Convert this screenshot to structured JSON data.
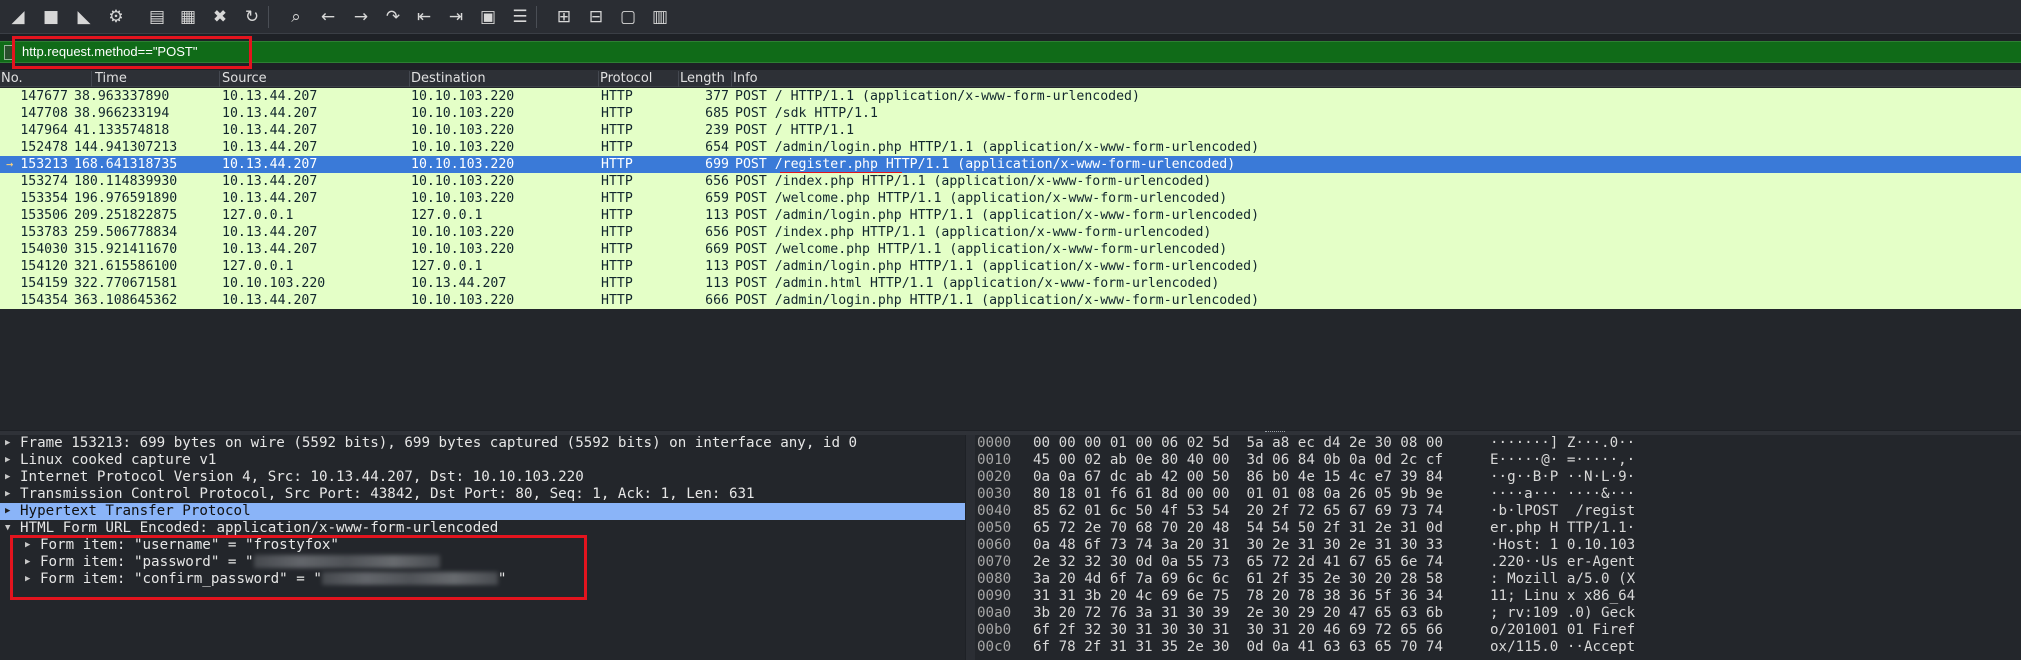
{
  "toolbar": {
    "buttons": [
      {
        "name": "start-capture-icon",
        "glyph": "◢"
      },
      {
        "name": "stop-capture-icon",
        "glyph": "■"
      },
      {
        "name": "restart-capture-icon",
        "glyph": "◣"
      },
      {
        "name": "capture-options-icon",
        "glyph": "⚙"
      },
      {
        "name": "open-file-icon",
        "glyph": "▤"
      },
      {
        "name": "save-file-icon",
        "glyph": "▦"
      },
      {
        "name": "close-file-icon",
        "glyph": "✖"
      },
      {
        "name": "reload-file-icon",
        "glyph": "↻"
      },
      {
        "name": "find-packet-icon",
        "glyph": "⌕"
      },
      {
        "name": "go-back-icon",
        "glyph": "←"
      },
      {
        "name": "go-forward-icon",
        "glyph": "→"
      },
      {
        "name": "go-to-packet-icon",
        "glyph": "↷"
      },
      {
        "name": "go-first-packet-icon",
        "glyph": "⇤"
      },
      {
        "name": "go-last-packet-icon",
        "glyph": "⇥"
      },
      {
        "name": "autoscroll-icon",
        "glyph": "▣"
      },
      {
        "name": "colorize-icon",
        "glyph": "☰"
      },
      {
        "name": "zoom-in-icon",
        "glyph": "⊞"
      },
      {
        "name": "zoom-out-icon",
        "glyph": "⊟"
      },
      {
        "name": "normal-size-icon",
        "glyph": "▢"
      },
      {
        "name": "resize-columns-icon",
        "glyph": "▥"
      }
    ]
  },
  "filter": {
    "value": "http.request.method==\"POST\""
  },
  "packet_list": {
    "columns": [
      "No.",
      "Time",
      "Source",
      "Destination",
      "Protocol",
      "Length",
      "Info"
    ],
    "selected_index": 4,
    "rows": [
      {
        "no": "147677",
        "time": "38.963337890",
        "src": "10.13.44.207",
        "dst": "10.10.103.220",
        "proto": "HTTP",
        "len": "377",
        "info": "POST / HTTP/1.1  (application/x-www-form-urlencoded)"
      },
      {
        "no": "147708",
        "time": "38.966233194",
        "src": "10.13.44.207",
        "dst": "10.10.103.220",
        "proto": "HTTP",
        "len": "685",
        "info": "POST /sdk HTTP/1.1"
      },
      {
        "no": "147964",
        "time": "41.133574818",
        "src": "10.13.44.207",
        "dst": "10.10.103.220",
        "proto": "HTTP",
        "len": "239",
        "info": "POST / HTTP/1.1"
      },
      {
        "no": "152478",
        "time": "144.941307213",
        "src": "10.13.44.207",
        "dst": "10.10.103.220",
        "proto": "HTTP",
        "len": "654",
        "info": "POST /admin/login.php HTTP/1.1  (application/x-www-form-urlencoded)"
      },
      {
        "no": "153213",
        "time": "168.641318735",
        "src": "10.13.44.207",
        "dst": "10.10.103.220",
        "proto": "HTTP",
        "len": "699",
        "info": "POST /register.php HTTP/1.1  (application/x-www-form-urlencoded)"
      },
      {
        "no": "153274",
        "time": "180.114839930",
        "src": "10.13.44.207",
        "dst": "10.10.103.220",
        "proto": "HTTP",
        "len": "656",
        "info": "POST /index.php HTTP/1.1  (application/x-www-form-urlencoded)"
      },
      {
        "no": "153354",
        "time": "196.976591890",
        "src": "10.13.44.207",
        "dst": "10.10.103.220",
        "proto": "HTTP",
        "len": "659",
        "info": "POST /welcome.php HTTP/1.1  (application/x-www-form-urlencoded)"
      },
      {
        "no": "153506",
        "time": "209.251822875",
        "src": "127.0.0.1",
        "dst": "127.0.0.1",
        "proto": "HTTP",
        "len": "113",
        "info": "POST /admin/login.php HTTP/1.1  (application/x-www-form-urlencoded)"
      },
      {
        "no": "153783",
        "time": "259.506778834",
        "src": "10.13.44.207",
        "dst": "10.10.103.220",
        "proto": "HTTP",
        "len": "656",
        "info": "POST /index.php HTTP/1.1  (application/x-www-form-urlencoded)"
      },
      {
        "no": "154030",
        "time": "315.921411670",
        "src": "10.13.44.207",
        "dst": "10.10.103.220",
        "proto": "HTTP",
        "len": "669",
        "info": "POST /welcome.php HTTP/1.1  (application/x-www-form-urlencoded)"
      },
      {
        "no": "154120",
        "time": "321.615586100",
        "src": "127.0.0.1",
        "dst": "127.0.0.1",
        "proto": "HTTP",
        "len": "113",
        "info": "POST /admin/login.php HTTP/1.1  (application/x-www-form-urlencoded)"
      },
      {
        "no": "154159",
        "time": "322.770671581",
        "src": "10.10.103.220",
        "dst": "10.13.44.207",
        "proto": "HTTP",
        "len": "113",
        "info": "POST /admin.html HTTP/1.1  (application/x-www-form-urlencoded)"
      },
      {
        "no": "154354",
        "time": "363.108645362",
        "src": "10.13.44.207",
        "dst": "10.10.103.220",
        "proto": "HTTP",
        "len": "666",
        "info": "POST /admin/login.php HTTP/1.1  (application/x-www-form-urlencoded)"
      }
    ]
  },
  "details": {
    "frame": "Frame 153213: 699 bytes on wire (5592 bits), 699 bytes captured (5592 bits) on interface any, id 0",
    "linux_cooked": "Linux cooked capture v1",
    "ip": "Internet Protocol Version 4, Src: 10.13.44.207, Dst: 10.10.103.220",
    "tcp": "Transmission Control Protocol, Src Port: 43842, Dst Port: 80, Seq: 1, Ack: 1, Len: 631",
    "http": "Hypertext Transfer Protocol",
    "form": "HTML Form URL Encoded: application/x-www-form-urlencoded",
    "item_username": "Form item: \"username\" = \"frostyfox\"",
    "item_password_prefix": "Form item: \"password\" = \"",
    "item_confirm_prefix": "Form item: \"confirm_password\" = \"",
    "quote_close": "\""
  },
  "bytes": [
    {
      "off": "0000",
      "hex": "00 00 00 01 00 06 02 5d  5a a8 ec d4 2e 30 08 00",
      "asc": "·······] Z···.0··"
    },
    {
      "off": "0010",
      "hex": "45 00 02 ab 0e 80 40 00  3d 06 84 0b 0a 0d 2c cf",
      "asc": "E·····@· =·····,·"
    },
    {
      "off": "0020",
      "hex": "0a 0a 67 dc ab 42 00 50  86 b0 4e 15 4c e7 39 84",
      "asc": "··g··B·P ··N·L·9·"
    },
    {
      "off": "0030",
      "hex": "80 18 01 f6 61 8d 00 00  01 01 08 0a 26 05 9b 9e",
      "asc": "····a··· ····&···"
    },
    {
      "off": "0040",
      "hex": "85 62 01 6c 50 4f 53 54  20 2f 72 65 67 69 73 74",
      "asc": "·b·lPOST  /regist"
    },
    {
      "off": "0050",
      "hex": "65 72 2e 70 68 70 20 48  54 54 50 2f 31 2e 31 0d",
      "asc": "er.php H TTP/1.1·"
    },
    {
      "off": "0060",
      "hex": "0a 48 6f 73 74 3a 20 31  30 2e 31 30 2e 31 30 33",
      "asc": "·Host: 1 0.10.103"
    },
    {
      "off": "0070",
      "hex": "2e 32 32 30 0d 0a 55 73  65 72 2d 41 67 65 6e 74",
      "asc": ".220··Us er-Agent"
    },
    {
      "off": "0080",
      "hex": "3a 20 4d 6f 7a 69 6c 6c  61 2f 35 2e 30 20 28 58",
      "asc": ": Mozill a/5.0 (X"
    },
    {
      "off": "0090",
      "hex": "31 31 3b 20 4c 69 6e 75  78 20 78 38 36 5f 36 34",
      "asc": "11; Linu x x86_64"
    },
    {
      "off": "00a0",
      "hex": "3b 20 72 76 3a 31 30 39  2e 30 29 20 47 65 63 6b",
      "asc": "; rv:109 .0) Geck"
    },
    {
      "off": "00b0",
      "hex": "6f 2f 32 30 31 30 30 31  30 31 20 46 69 72 65 66",
      "asc": "o/201001 01 Firef"
    },
    {
      "off": "00c0",
      "hex": "6f 78 2f 31 31 35 2e 30  0d 0a 41 63 63 65 70 74",
      "asc": "ox/115.0 ··Accept"
    }
  ]
}
